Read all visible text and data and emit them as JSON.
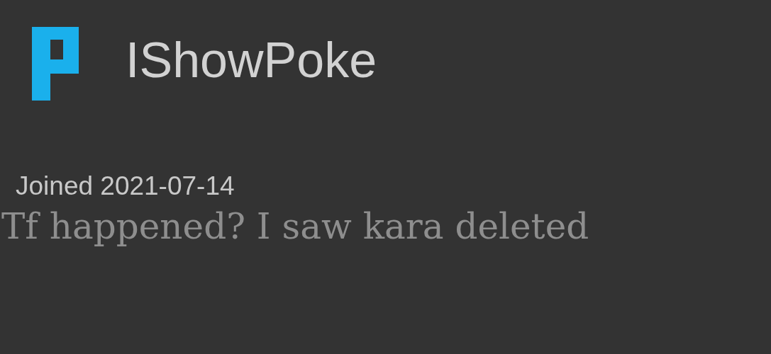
{
  "profile": {
    "username": "IShowPoke",
    "joined": "Joined 2021-07-14"
  },
  "message": "Tf happened? I saw kara deleted"
}
